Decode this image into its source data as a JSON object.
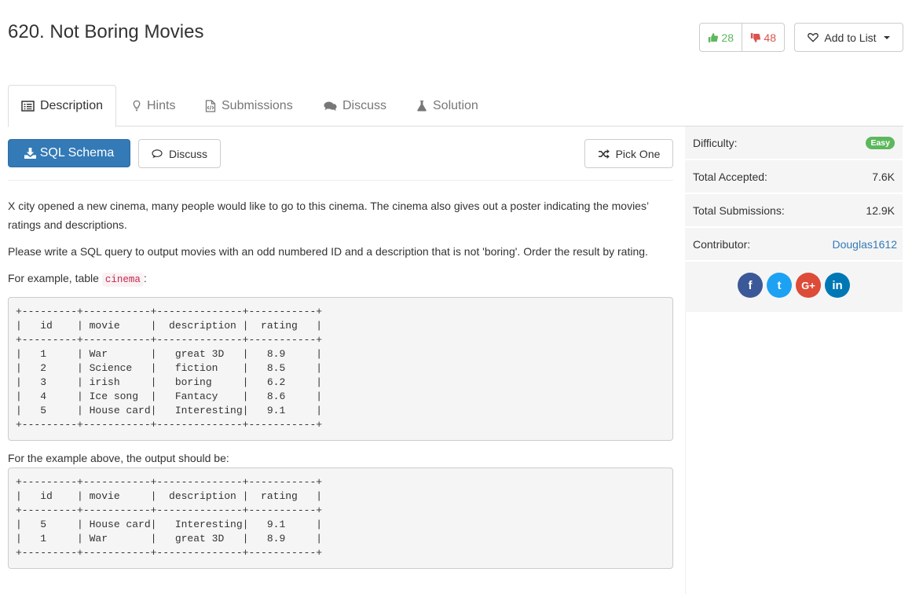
{
  "problem": {
    "title": "620. Not Boring Movies"
  },
  "votes": {
    "up": "28",
    "down": "48"
  },
  "add_list_label": "Add to List",
  "tabs": [
    {
      "label": "Description",
      "icon": "list-icon"
    },
    {
      "label": "Hints",
      "icon": "lightbulb-icon"
    },
    {
      "label": "Submissions",
      "icon": "code-file-icon"
    },
    {
      "label": "Discuss",
      "icon": "comments-icon"
    },
    {
      "label": "Solution",
      "icon": "flask-icon"
    }
  ],
  "buttons": {
    "schema": "SQL Schema",
    "discuss": "Discuss",
    "pick": "Pick One"
  },
  "description": {
    "p1": "X city opened a new cinema, many people would like to go to this cinema. The cinema also gives out a poster indicating the movies’ ratings and descriptions.",
    "p2": "Please write a SQL query to output movies with an odd numbered ID and a description that is not 'boring'. Order the result by rating.",
    "p3_prefix": "For example, table ",
    "p3_code": "cinema",
    "p3_suffix": ":",
    "table1": "+---------+-----------+--------------+-----------+\n|   id    | movie     |  description |  rating   |\n+---------+-----------+--------------+-----------+\n|   1     | War       |   great 3D   |   8.9     |\n|   2     | Science   |   fiction    |   8.5     |\n|   3     | irish     |   boring     |   6.2     |\n|   4     | Ice song  |   Fantacy    |   8.6     |\n|   5     | House card|   Interesting|   9.1     |\n+---------+-----------+--------------+-----------+",
    "p4": "For the example above, the output should be:",
    "table2": "+---------+-----------+--------------+-----------+\n|   id    | movie     |  description |  rating   |\n+---------+-----------+--------------+-----------+\n|   5     | House card|   Interesting|   9.1     |\n|   1     | War       |   great 3D   |   8.9     |\n+---------+-----------+--------------+-----------+"
  },
  "sidebar": {
    "difficulty_label": "Difficulty:",
    "difficulty_value": "Easy",
    "accepted_label": "Total Accepted:",
    "accepted_value": "7.6K",
    "submissions_label": "Total Submissions:",
    "submissions_value": "12.9K",
    "contributor_label": "Contributor:",
    "contributor_value": "Douglas1612",
    "social": [
      "f",
      "t",
      "G+",
      "in"
    ]
  },
  "colors": {
    "primary": "#337ab7",
    "success": "#5cb85c",
    "danger": "#d9534f"
  }
}
